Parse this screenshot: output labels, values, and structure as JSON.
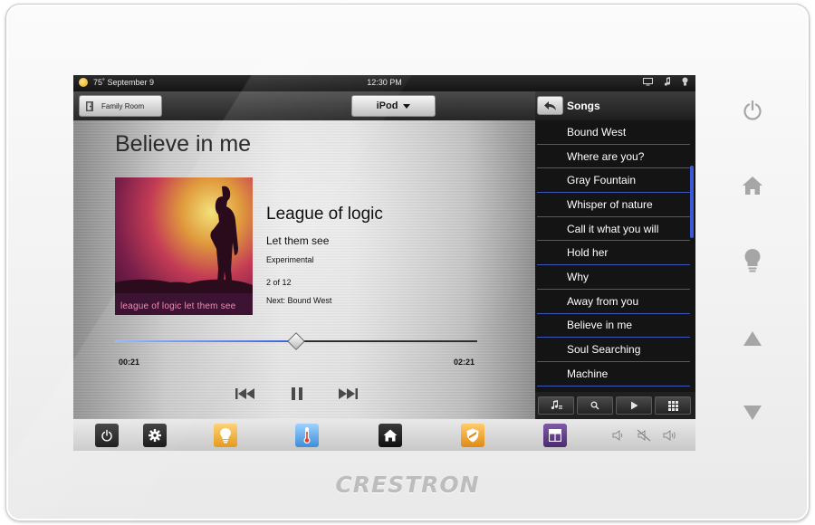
{
  "brand": "CRESTRON",
  "status": {
    "temperature": "75˚",
    "date": "September 9",
    "time": "12:30 PM"
  },
  "topbar": {
    "room": "Family Room",
    "source": "iPod"
  },
  "now_playing": {
    "title": "Believe in me",
    "artist": "League of logic",
    "album": "Let them see",
    "genre": "Experimental",
    "track": "2 of 12",
    "next": "Next: Bound West",
    "album_art_text": "league of logic  let them see",
    "elapsed": "00:21",
    "duration": "02:21",
    "progress_fraction": 0.5
  },
  "playlist": {
    "title": "Songs",
    "items": [
      "Bound West",
      "Where are you?",
      "Gray Fountain",
      "Whisper of nature",
      "Call it what you will",
      "Hold her",
      "Why",
      "Away from you",
      "Believe in me",
      "Soul Searching",
      "Machine"
    ]
  },
  "colors": {
    "accent": "#3a58d8",
    "screen_bg": "#1c1c1c",
    "bezel": "#f4f4f4"
  },
  "icons": {
    "side": [
      "power-icon",
      "home-icon",
      "lightbulb-icon",
      "up-arrow-icon",
      "down-arrow-icon"
    ],
    "bottom": [
      "power-icon",
      "gear-icon",
      "lights-icon",
      "thermostat-icon",
      "home-icon",
      "security-icon",
      "shades-icon",
      "volume-down-icon",
      "mute-icon",
      "volume-up-icon"
    ]
  }
}
